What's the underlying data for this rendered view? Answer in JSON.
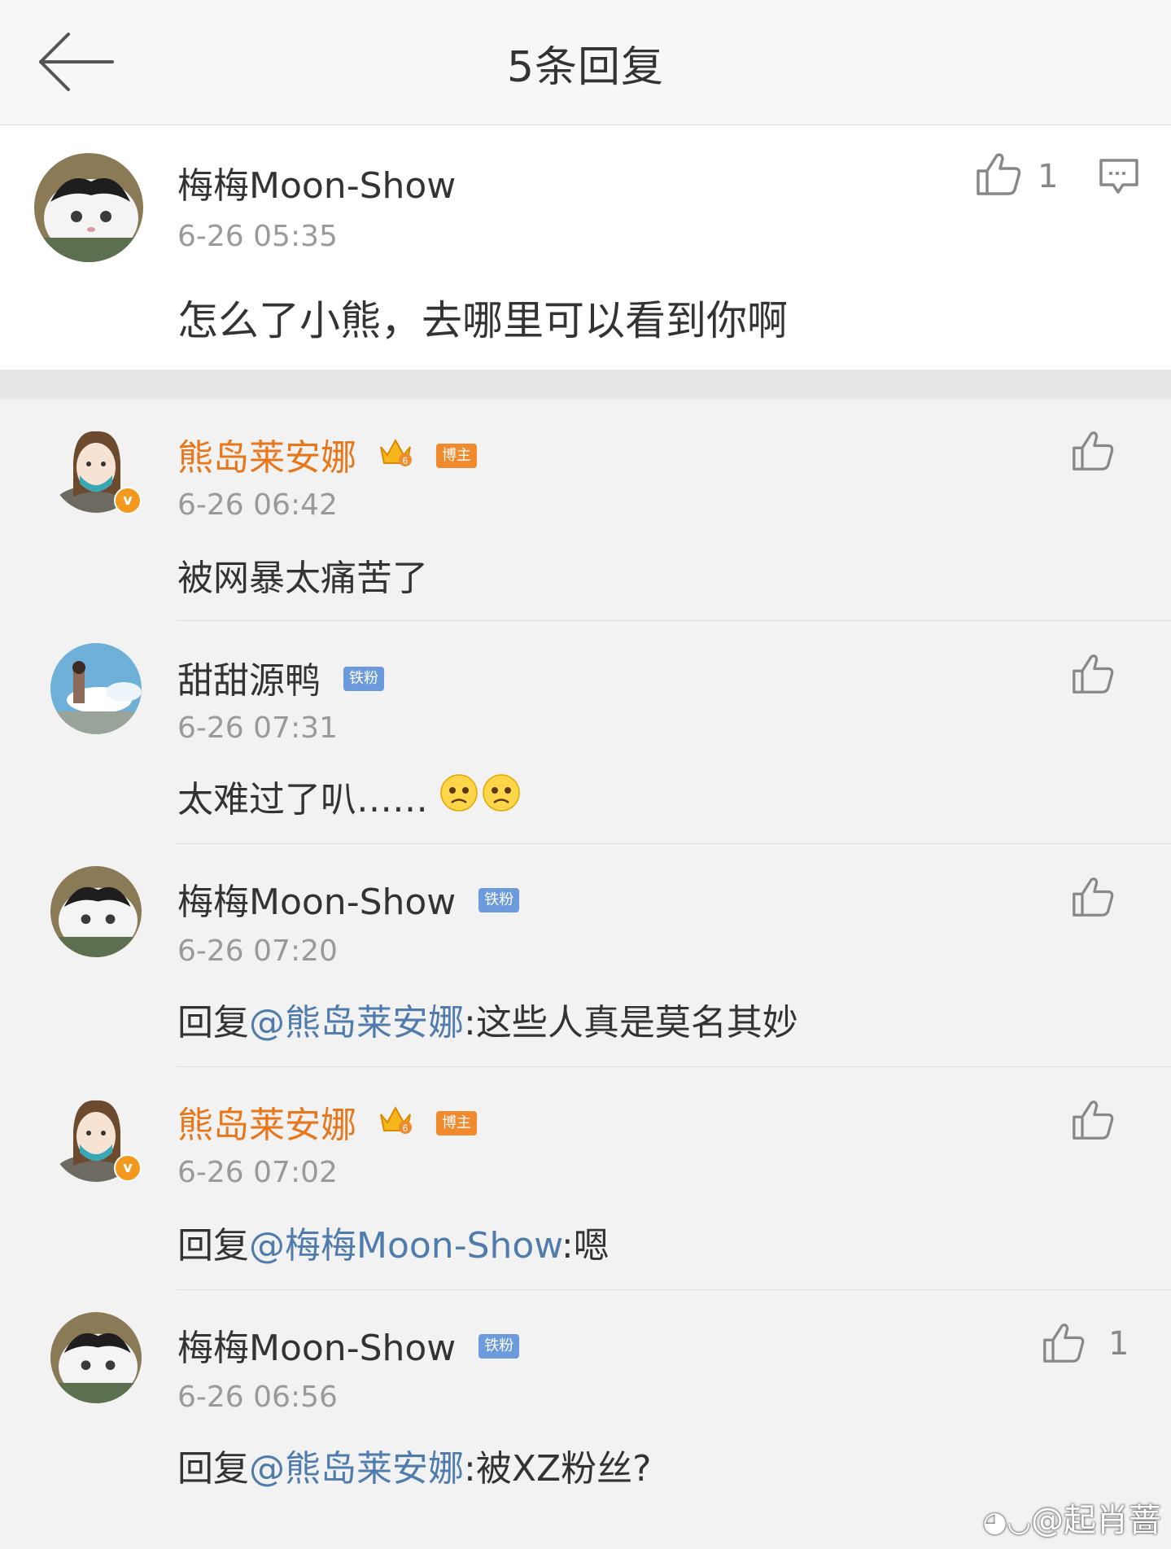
{
  "header": {
    "title": "5条回复"
  },
  "main_comment": {
    "name": "梅梅Moon-Show",
    "time": "6-26 05:35",
    "content": "怎么了小熊，去哪里可以看到你啊",
    "like_count": "1"
  },
  "replies": [
    {
      "name": "熊岛莱安娜",
      "badge": "博主",
      "time": "6-26 06:42",
      "content": "被网暴太痛苦了",
      "prefix": "",
      "mention": "",
      "suffix": ""
    },
    {
      "name": "甜甜源鸭",
      "badge": "铁粉",
      "time": "6-26 07:31",
      "content": "太难过了叭……",
      "prefix": "",
      "mention": "",
      "suffix": ""
    },
    {
      "name": "梅梅Moon-Show",
      "badge": "铁粉",
      "time": "6-26 07:20",
      "prefix": "回复",
      "mention": "@熊岛莱安娜",
      "suffix": ":这些人真是莫名其妙"
    },
    {
      "name": "熊岛莱安娜",
      "badge": "博主",
      "time": "6-26 07:02",
      "prefix": "回复",
      "mention": "@梅梅Moon-Show",
      "suffix": ":嗯"
    },
    {
      "name": "梅梅Moon-Show",
      "badge": "铁粉",
      "time": "6-26 06:56",
      "prefix": "回复",
      "mention": "@熊岛莱安娜",
      "suffix": ":被XZ粉丝?",
      "like_count": "1"
    }
  ],
  "watermark": "@起肖蔷",
  "colors": {
    "orange_name": "#e8761a",
    "mention": "#4f7cad",
    "fan_badge": "#6b9bdc",
    "host_badge": "#f08a2d"
  }
}
